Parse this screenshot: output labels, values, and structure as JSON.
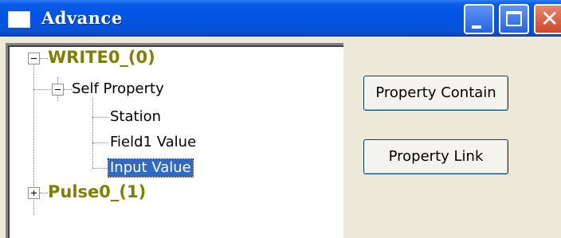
{
  "window": {
    "title": "Advance"
  },
  "tree": {
    "nodes": [
      {
        "label": "WRITE0_(0)",
        "expanded": true
      },
      {
        "label": "Self Property",
        "expanded": true
      },
      {
        "label": "Station"
      },
      {
        "label": "Field1 Value"
      },
      {
        "label": "Input Value",
        "selected": true
      },
      {
        "label": "Pulse0_(1)",
        "expanded": false
      }
    ]
  },
  "buttons": {
    "property_contain": "Property Contain",
    "property_link": "Property Link"
  },
  "colors": {
    "title_bar": "#0055e5",
    "root_node_text": "#808000",
    "selection": "#316ac5",
    "dialog_background": "#ece9d8"
  }
}
